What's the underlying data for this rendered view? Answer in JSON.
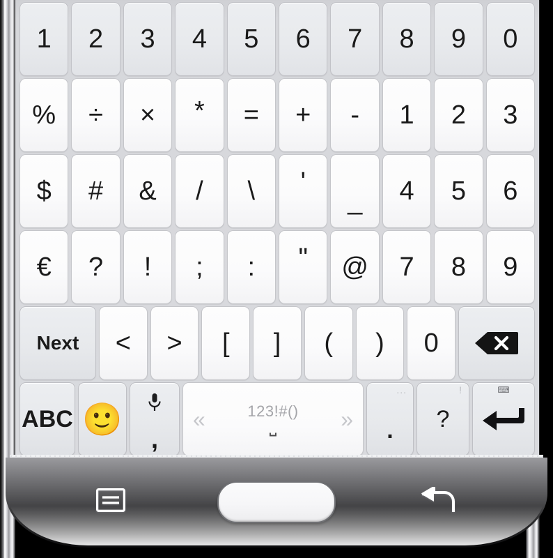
{
  "device": {
    "name": "Samsung Galaxy smartphone",
    "bezel_color": "#f3f3f5",
    "rail_color": "#cfcfd3"
  },
  "keyboard": {
    "name": "Samsung symbols keyboard",
    "background_color": "#d9dade",
    "key_color": "#fbfbfc",
    "function_key_color": "#e7e9ec",
    "text_color": "#1a1a1a",
    "rows": [
      {
        "id": "row-numbers",
        "keys": [
          {
            "label": "1",
            "name": "key-1"
          },
          {
            "label": "2",
            "name": "key-2"
          },
          {
            "label": "3",
            "name": "key-3"
          },
          {
            "label": "4",
            "name": "key-4"
          },
          {
            "label": "5",
            "name": "key-5"
          },
          {
            "label": "6",
            "name": "key-6"
          },
          {
            "label": "7",
            "name": "key-7"
          },
          {
            "label": "8",
            "name": "key-8"
          },
          {
            "label": "9",
            "name": "key-9"
          },
          {
            "label": "0",
            "name": "key-0"
          }
        ]
      },
      {
        "id": "row-math",
        "keys": [
          {
            "label": "%",
            "name": "key-percent"
          },
          {
            "label": "÷",
            "name": "key-divide"
          },
          {
            "label": "×",
            "name": "key-multiply"
          },
          {
            "label": "*",
            "name": "key-asterisk"
          },
          {
            "label": "=",
            "name": "key-equals"
          },
          {
            "label": "+",
            "name": "key-plus"
          },
          {
            "label": "-",
            "name": "key-minus"
          },
          {
            "label": "1",
            "name": "key-1-alt"
          },
          {
            "label": "2",
            "name": "key-2-alt"
          },
          {
            "label": "3",
            "name": "key-3-alt"
          }
        ]
      },
      {
        "id": "row-symbols-1",
        "keys": [
          {
            "label": "$",
            "name": "key-dollar"
          },
          {
            "label": "#",
            "name": "key-hash"
          },
          {
            "label": "&",
            "name": "key-ampersand"
          },
          {
            "label": "/",
            "name": "key-slash"
          },
          {
            "label": "\\",
            "name": "key-backslash"
          },
          {
            "label": "'",
            "name": "key-apostrophe"
          },
          {
            "label": "_",
            "name": "key-underscore"
          },
          {
            "label": "4",
            "name": "key-4-alt"
          },
          {
            "label": "5",
            "name": "key-5-alt"
          },
          {
            "label": "6",
            "name": "key-6-alt"
          }
        ]
      },
      {
        "id": "row-symbols-2",
        "keys": [
          {
            "label": "€",
            "name": "key-euro"
          },
          {
            "label": "?",
            "name": "key-question"
          },
          {
            "label": "!",
            "name": "key-exclamation"
          },
          {
            "label": ";",
            "name": "key-semicolon"
          },
          {
            "label": ":",
            "name": "key-colon"
          },
          {
            "label": "\"",
            "name": "key-quote"
          },
          {
            "label": "@",
            "name": "key-at"
          },
          {
            "label": "7",
            "name": "key-7-alt"
          },
          {
            "label": "8",
            "name": "key-8-alt"
          },
          {
            "label": "9",
            "name": "key-9-alt"
          }
        ]
      },
      {
        "id": "row-brackets",
        "keys": [
          {
            "label": "Next",
            "name": "key-next"
          },
          {
            "label": "<",
            "name": "key-less-than"
          },
          {
            "label": ">",
            "name": "key-greater-than"
          },
          {
            "label": "[",
            "name": "key-bracket-open"
          },
          {
            "label": "]",
            "name": "key-bracket-close"
          },
          {
            "label": "(",
            "name": "key-paren-open"
          },
          {
            "label": ")",
            "name": "key-paren-close"
          },
          {
            "label": "0",
            "name": "key-0-alt"
          },
          {
            "label": "",
            "name": "key-backspace",
            "icon": "backspace-icon"
          }
        ]
      }
    ],
    "bottom_row": {
      "abc": {
        "label": "ABC",
        "name": "key-abc"
      },
      "emoji": {
        "label": "🙂",
        "name": "key-emoji"
      },
      "mic": {
        "icon": "microphone-icon",
        "label": ",",
        "name": "key-mic-comma"
      },
      "space": {
        "label": "123!#()",
        "glyph": "⎵",
        "prev": "«",
        "next": "»",
        "name": "key-spacebar"
      },
      "period": {
        "label": ".",
        "hint": "...",
        "name": "key-period"
      },
      "question": {
        "label": "?",
        "hint": "!",
        "name": "key-question-bottom"
      },
      "enter": {
        "icon": "enter-arrow-icon",
        "hint": "⌨",
        "name": "key-enter"
      }
    }
  },
  "navigation": {
    "menu": {
      "icon": "menu-icon",
      "name": "nav-menu-button"
    },
    "home": {
      "name": "nav-home-button"
    },
    "back": {
      "icon": "back-arrow-icon",
      "name": "nav-back-button"
    }
  }
}
